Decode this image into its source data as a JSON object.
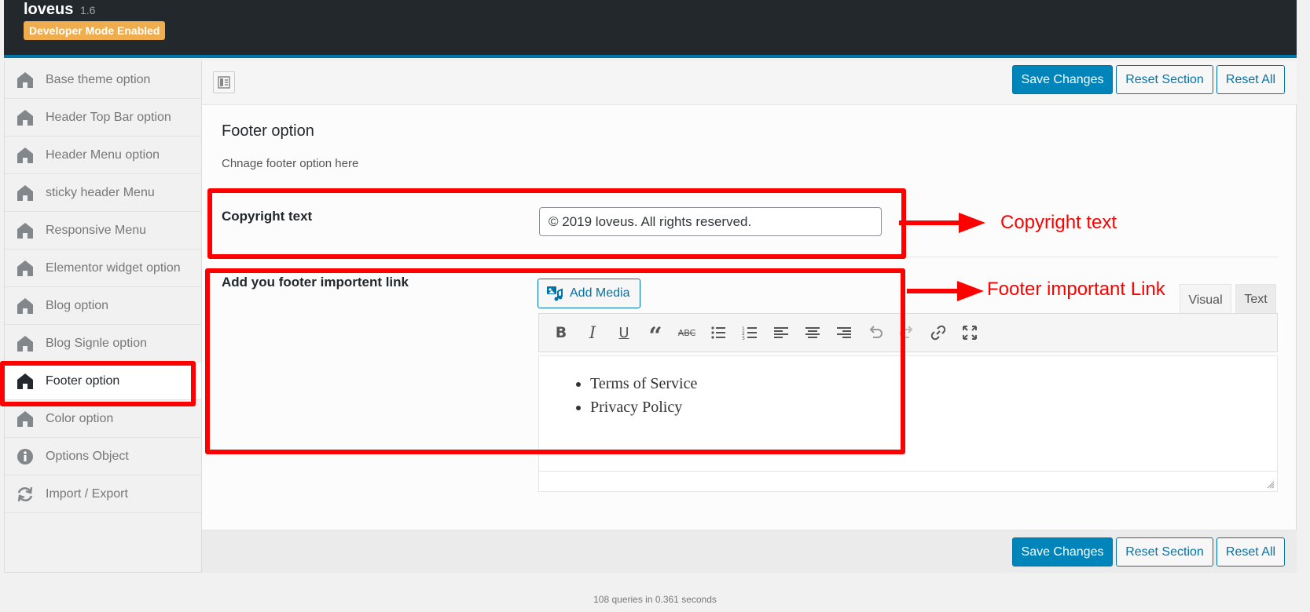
{
  "header": {
    "title": "loveus",
    "version": "1.6",
    "badge": "Developer Mode Enabled"
  },
  "sidebar": {
    "items": [
      {
        "label": "Base theme option",
        "icon": "home-icon"
      },
      {
        "label": "Header Top Bar option",
        "icon": "home-icon"
      },
      {
        "label": "Header Menu option",
        "icon": "home-icon"
      },
      {
        "label": "sticky header Menu",
        "icon": "home-icon"
      },
      {
        "label": "Responsive Menu",
        "icon": "home-icon"
      },
      {
        "label": "Elementor widget option",
        "icon": "home-icon"
      },
      {
        "label": "Blog option",
        "icon": "home-icon"
      },
      {
        "label": "Blog Signle option",
        "icon": "home-icon"
      },
      {
        "label": "Footer option",
        "icon": "home-icon",
        "active": true
      },
      {
        "label": "Color option",
        "icon": "home-icon"
      },
      {
        "label": "Options Object",
        "icon": "info-icon"
      },
      {
        "label": "Import / Export",
        "icon": "refresh-icon"
      }
    ]
  },
  "toolbar": {
    "save_label": "Save Changes",
    "reset_section_label": "Reset Section",
    "reset_all_label": "Reset All"
  },
  "section": {
    "title": "Footer option",
    "description": "Chnage footer option here"
  },
  "fields": {
    "copyright": {
      "label": "Copyright text",
      "value": "© 2019 loveus. All rights reserved."
    },
    "links": {
      "label": "Add you footer importent link",
      "add_media_label": "Add Media",
      "tab_visual": "Visual",
      "tab_text": "Text",
      "content_items": [
        "Terms of Service",
        "Privacy Policy"
      ],
      "toolbar_icons": [
        "bold-icon",
        "italic-icon",
        "underline-icon",
        "blockquote-icon",
        "strikethrough-icon",
        "bullet-list-icon",
        "numbered-list-icon",
        "align-left-icon",
        "align-center-icon",
        "align-right-icon",
        "undo-icon",
        "redo-icon",
        "link-icon",
        "fullscreen-icon"
      ]
    }
  },
  "annotations": {
    "copyright": "Copyright text",
    "links": "Footer important Link",
    "color": "#ff0000"
  },
  "wp_footer": "108 queries in 0.361 seconds",
  "colors": {
    "primary": "#0085ba",
    "header_bg": "#23282d",
    "badge": "#f0ad4e"
  }
}
